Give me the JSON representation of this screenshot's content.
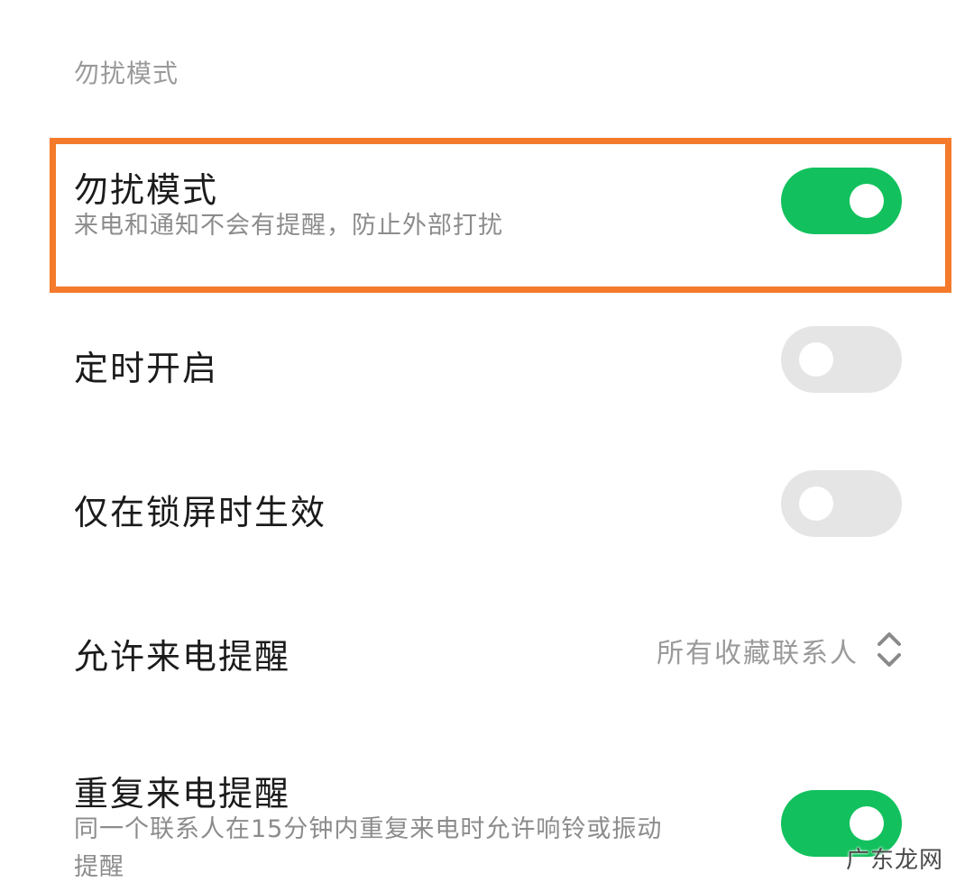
{
  "section": {
    "header": "勿扰模式"
  },
  "settings": [
    {
      "title": "勿扰模式",
      "subtitle": "来电和通知不会有提醒，防止外部打扰",
      "toggle_on": true
    },
    {
      "title": "定时开启",
      "toggle_on": false
    },
    {
      "title": "仅在锁屏时生效",
      "toggle_on": false
    },
    {
      "title": "允许来电提醒",
      "value": "所有收藏联系人"
    },
    {
      "title": "重复来电提醒",
      "subtitle_line1": "同一个联系人在15分钟内重复来电时允许响铃或振动",
      "subtitle_line2": "提醒",
      "toggle_on": true
    }
  ],
  "colors": {
    "toggle_on": "#12c15d",
    "toggle_off": "#e5e5e5",
    "highlight": "#f47a2c"
  },
  "icons": {
    "selector": "chevron-up-down-icon"
  },
  "watermark": "广东龙网"
}
